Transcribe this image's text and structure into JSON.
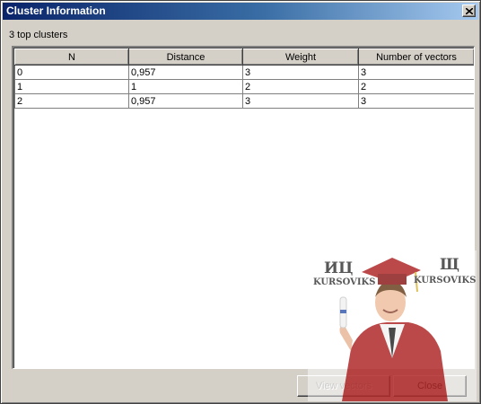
{
  "window": {
    "title": "Cluster Information"
  },
  "caption": "3 top clusters",
  "table": {
    "columns": [
      "N",
      "Distance",
      "Weight",
      "Number of vectors"
    ],
    "rows": [
      [
        "0",
        "0,957",
        "3",
        "3"
      ],
      [
        "1",
        "1",
        "2",
        "2"
      ],
      [
        "2",
        "0,957",
        "3",
        "3"
      ]
    ]
  },
  "buttons": {
    "view_vectors": "View vectors",
    "close": "Close"
  },
  "watermark": {
    "left_logo": "ИЦ",
    "left_name": "KURSOVIKS",
    "right_logo": "Щ",
    "right_name": "KURSOVIKS"
  },
  "icons": {
    "close": "close-x-icon"
  },
  "colors": {
    "titlebar_start": "#0a246a",
    "titlebar_end": "#a6caf0",
    "face": "#d4d0c8",
    "gown": "#b02a2a"
  }
}
